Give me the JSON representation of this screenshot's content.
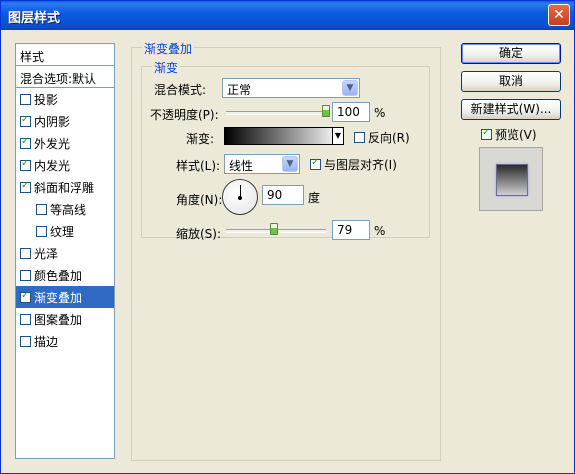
{
  "window": {
    "title": "图层样式",
    "close_glyph": "✕"
  },
  "left": {
    "header": "样式",
    "blending": "混合选项:默认",
    "items": [
      {
        "label": "投影",
        "checked": false,
        "indent": false,
        "selected": false
      },
      {
        "label": "内阴影",
        "checked": true,
        "indent": false,
        "selected": false
      },
      {
        "label": "外发光",
        "checked": true,
        "indent": false,
        "selected": false
      },
      {
        "label": "内发光",
        "checked": true,
        "indent": false,
        "selected": false
      },
      {
        "label": "斜面和浮雕",
        "checked": true,
        "indent": false,
        "selected": false
      },
      {
        "label": "等高线",
        "checked": false,
        "indent": true,
        "selected": false
      },
      {
        "label": "纹理",
        "checked": false,
        "indent": true,
        "selected": false
      },
      {
        "label": "光泽",
        "checked": false,
        "indent": false,
        "selected": false
      },
      {
        "label": "颜色叠加",
        "checked": false,
        "indent": false,
        "selected": false
      },
      {
        "label": "渐变叠加",
        "checked": true,
        "indent": false,
        "selected": true
      },
      {
        "label": "图案叠加",
        "checked": false,
        "indent": false,
        "selected": false
      },
      {
        "label": "描边",
        "checked": false,
        "indent": false,
        "selected": false
      }
    ]
  },
  "panel": {
    "outer_legend": "渐变叠加",
    "inner_legend": "渐变",
    "blend_mode": {
      "label": "混合模式:",
      "value": "正常"
    },
    "opacity": {
      "label": "不透明度(P):",
      "value": "100",
      "unit": "%",
      "slider_fraction": 1.0
    },
    "gradient": {
      "label": "渐变:",
      "reverse_label": "反向(R)",
      "reverse_checked": false
    },
    "style": {
      "label": "样式(L):",
      "value": "线性",
      "align_label": "与图层对齐(I)",
      "align_checked": true
    },
    "angle": {
      "label": "角度(N):",
      "value": "90",
      "unit": "度"
    },
    "scale": {
      "label": "缩放(S):",
      "value": "79",
      "unit": "%",
      "slider_fraction": 0.48
    }
  },
  "buttons": {
    "ok": "确定",
    "cancel": "取消",
    "new_style": "新建样式(W)...",
    "preview_label": "预览(V)",
    "preview_checked": true
  }
}
